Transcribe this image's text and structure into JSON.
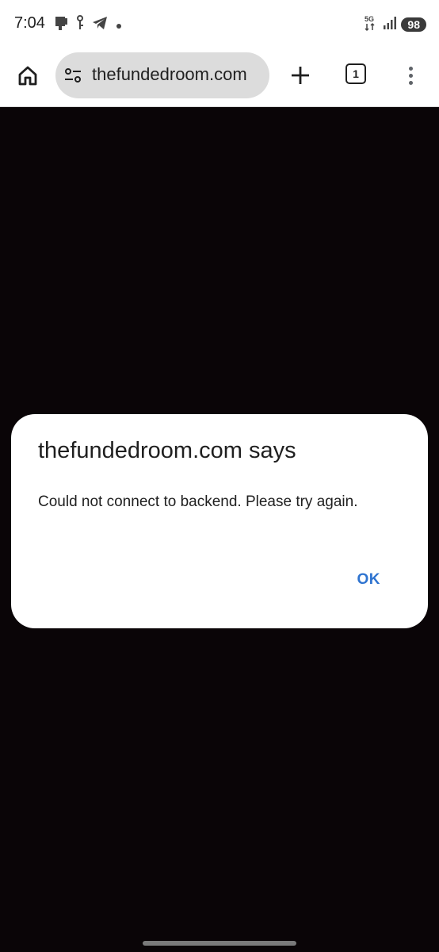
{
  "status_bar": {
    "time": "7:04",
    "network": "5G",
    "battery": "98"
  },
  "toolbar": {
    "url": "thefundedroom.com",
    "tab_count": "1"
  },
  "dialog": {
    "title": "thefundedroom.com says",
    "message": "Could not connect to backend. Please try again.",
    "ok_label": "OK"
  },
  "colors": {
    "accent": "#2f74d0",
    "page_background": "#0a0507",
    "dialog_background": "#ffffff"
  }
}
